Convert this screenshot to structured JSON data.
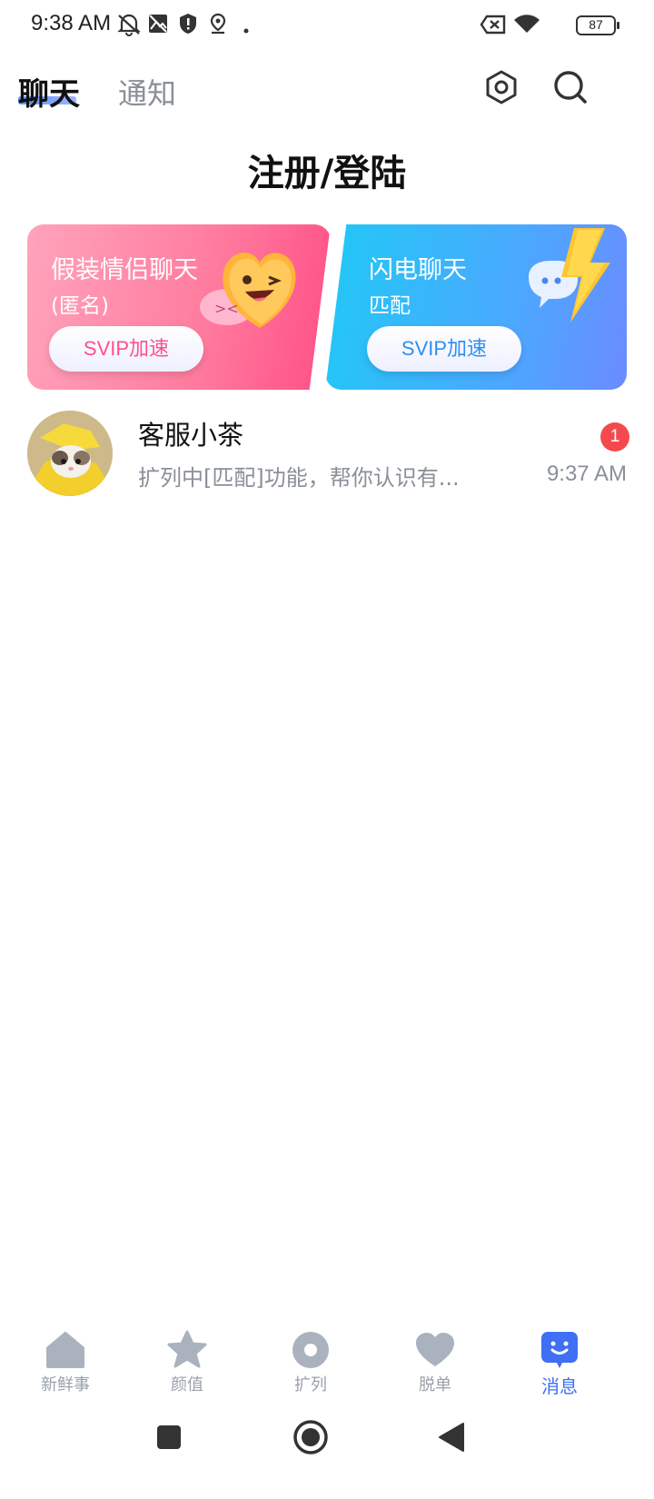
{
  "status_bar": {
    "time": "9:38 AM",
    "battery": "87",
    "icons": [
      "mute-alarm-icon",
      "image-icon",
      "shield-icon",
      "location-icon",
      "dot-icon",
      "sim-off-icon",
      "wifi-icon",
      "battery-icon"
    ]
  },
  "header": {
    "tabs": [
      {
        "label": "聊天",
        "active": true
      },
      {
        "label": "通知",
        "active": false
      }
    ],
    "icons": [
      "settings-hex-icon",
      "search-icon"
    ]
  },
  "page_title": "注册/登陆",
  "promo_cards": [
    {
      "title": "假装情侣聊天",
      "subtitle": "(匿名)",
      "button": "SVIP加速",
      "icon": "heart-face-icon",
      "color": "#ff6f98"
    },
    {
      "title": "闪电聊天",
      "subtitle": "匹配",
      "button": "SVIP加速",
      "icon": "lightning-chat-icon",
      "color": "#3cb6fb"
    }
  ],
  "chats": [
    {
      "name": "客服小茶",
      "preview": "扩列中[匹配]功能，帮你认识有...",
      "time": "9:37 AM",
      "unread": "1"
    }
  ],
  "bottom_nav": [
    {
      "label": "新鲜事",
      "icon": "home-icon",
      "active": false
    },
    {
      "label": "颜值",
      "icon": "star-icon",
      "active": false
    },
    {
      "label": "扩列",
      "icon": "circle-icon",
      "active": false
    },
    {
      "label": "脱单",
      "icon": "heart-icon",
      "active": false
    },
    {
      "label": "消息",
      "icon": "message-face-icon",
      "active": true
    }
  ],
  "colors": {
    "accent": "#3e6ff5",
    "inactive": "#9aa1ab",
    "badge": "#f44a4e"
  }
}
